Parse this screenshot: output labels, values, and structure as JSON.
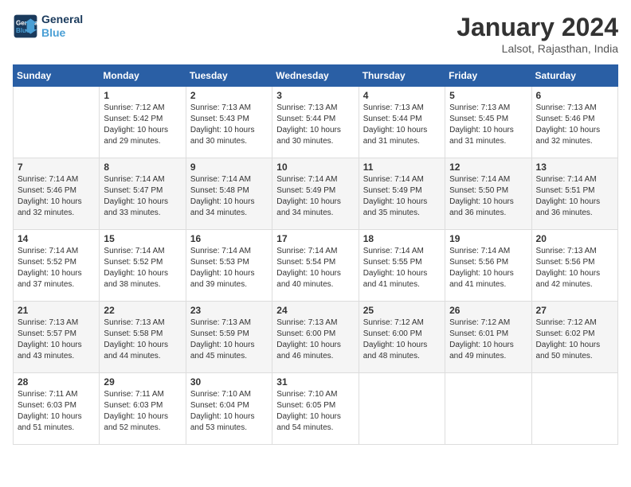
{
  "header": {
    "logo_line1": "General",
    "logo_line2": "Blue",
    "month": "January 2024",
    "location": "Lalsot, Rajasthan, India"
  },
  "days_of_week": [
    "Sunday",
    "Monday",
    "Tuesday",
    "Wednesday",
    "Thursday",
    "Friday",
    "Saturday"
  ],
  "weeks": [
    [
      {
        "day": "",
        "sunrise": "",
        "sunset": "",
        "daylight": ""
      },
      {
        "day": "1",
        "sunrise": "Sunrise: 7:12 AM",
        "sunset": "Sunset: 5:42 PM",
        "daylight": "Daylight: 10 hours and 29 minutes."
      },
      {
        "day": "2",
        "sunrise": "Sunrise: 7:13 AM",
        "sunset": "Sunset: 5:43 PM",
        "daylight": "Daylight: 10 hours and 30 minutes."
      },
      {
        "day": "3",
        "sunrise": "Sunrise: 7:13 AM",
        "sunset": "Sunset: 5:44 PM",
        "daylight": "Daylight: 10 hours and 30 minutes."
      },
      {
        "day": "4",
        "sunrise": "Sunrise: 7:13 AM",
        "sunset": "Sunset: 5:44 PM",
        "daylight": "Daylight: 10 hours and 31 minutes."
      },
      {
        "day": "5",
        "sunrise": "Sunrise: 7:13 AM",
        "sunset": "Sunset: 5:45 PM",
        "daylight": "Daylight: 10 hours and 31 minutes."
      },
      {
        "day": "6",
        "sunrise": "Sunrise: 7:13 AM",
        "sunset": "Sunset: 5:46 PM",
        "daylight": "Daylight: 10 hours and 32 minutes."
      }
    ],
    [
      {
        "day": "7",
        "sunrise": "Sunrise: 7:14 AM",
        "sunset": "Sunset: 5:46 PM",
        "daylight": "Daylight: 10 hours and 32 minutes."
      },
      {
        "day": "8",
        "sunrise": "Sunrise: 7:14 AM",
        "sunset": "Sunset: 5:47 PM",
        "daylight": "Daylight: 10 hours and 33 minutes."
      },
      {
        "day": "9",
        "sunrise": "Sunrise: 7:14 AM",
        "sunset": "Sunset: 5:48 PM",
        "daylight": "Daylight: 10 hours and 34 minutes."
      },
      {
        "day": "10",
        "sunrise": "Sunrise: 7:14 AM",
        "sunset": "Sunset: 5:49 PM",
        "daylight": "Daylight: 10 hours and 34 minutes."
      },
      {
        "day": "11",
        "sunrise": "Sunrise: 7:14 AM",
        "sunset": "Sunset: 5:49 PM",
        "daylight": "Daylight: 10 hours and 35 minutes."
      },
      {
        "day": "12",
        "sunrise": "Sunrise: 7:14 AM",
        "sunset": "Sunset: 5:50 PM",
        "daylight": "Daylight: 10 hours and 36 minutes."
      },
      {
        "day": "13",
        "sunrise": "Sunrise: 7:14 AM",
        "sunset": "Sunset: 5:51 PM",
        "daylight": "Daylight: 10 hours and 36 minutes."
      }
    ],
    [
      {
        "day": "14",
        "sunrise": "Sunrise: 7:14 AM",
        "sunset": "Sunset: 5:52 PM",
        "daylight": "Daylight: 10 hours and 37 minutes."
      },
      {
        "day": "15",
        "sunrise": "Sunrise: 7:14 AM",
        "sunset": "Sunset: 5:52 PM",
        "daylight": "Daylight: 10 hours and 38 minutes."
      },
      {
        "day": "16",
        "sunrise": "Sunrise: 7:14 AM",
        "sunset": "Sunset: 5:53 PM",
        "daylight": "Daylight: 10 hours and 39 minutes."
      },
      {
        "day": "17",
        "sunrise": "Sunrise: 7:14 AM",
        "sunset": "Sunset: 5:54 PM",
        "daylight": "Daylight: 10 hours and 40 minutes."
      },
      {
        "day": "18",
        "sunrise": "Sunrise: 7:14 AM",
        "sunset": "Sunset: 5:55 PM",
        "daylight": "Daylight: 10 hours and 41 minutes."
      },
      {
        "day": "19",
        "sunrise": "Sunrise: 7:14 AM",
        "sunset": "Sunset: 5:56 PM",
        "daylight": "Daylight: 10 hours and 41 minutes."
      },
      {
        "day": "20",
        "sunrise": "Sunrise: 7:13 AM",
        "sunset": "Sunset: 5:56 PM",
        "daylight": "Daylight: 10 hours and 42 minutes."
      }
    ],
    [
      {
        "day": "21",
        "sunrise": "Sunrise: 7:13 AM",
        "sunset": "Sunset: 5:57 PM",
        "daylight": "Daylight: 10 hours and 43 minutes."
      },
      {
        "day": "22",
        "sunrise": "Sunrise: 7:13 AM",
        "sunset": "Sunset: 5:58 PM",
        "daylight": "Daylight: 10 hours and 44 minutes."
      },
      {
        "day": "23",
        "sunrise": "Sunrise: 7:13 AM",
        "sunset": "Sunset: 5:59 PM",
        "daylight": "Daylight: 10 hours and 45 minutes."
      },
      {
        "day": "24",
        "sunrise": "Sunrise: 7:13 AM",
        "sunset": "Sunset: 6:00 PM",
        "daylight": "Daylight: 10 hours and 46 minutes."
      },
      {
        "day": "25",
        "sunrise": "Sunrise: 7:12 AM",
        "sunset": "Sunset: 6:00 PM",
        "daylight": "Daylight: 10 hours and 48 minutes."
      },
      {
        "day": "26",
        "sunrise": "Sunrise: 7:12 AM",
        "sunset": "Sunset: 6:01 PM",
        "daylight": "Daylight: 10 hours and 49 minutes."
      },
      {
        "day": "27",
        "sunrise": "Sunrise: 7:12 AM",
        "sunset": "Sunset: 6:02 PM",
        "daylight": "Daylight: 10 hours and 50 minutes."
      }
    ],
    [
      {
        "day": "28",
        "sunrise": "Sunrise: 7:11 AM",
        "sunset": "Sunset: 6:03 PM",
        "daylight": "Daylight: 10 hours and 51 minutes."
      },
      {
        "day": "29",
        "sunrise": "Sunrise: 7:11 AM",
        "sunset": "Sunset: 6:03 PM",
        "daylight": "Daylight: 10 hours and 52 minutes."
      },
      {
        "day": "30",
        "sunrise": "Sunrise: 7:10 AM",
        "sunset": "Sunset: 6:04 PM",
        "daylight": "Daylight: 10 hours and 53 minutes."
      },
      {
        "day": "31",
        "sunrise": "Sunrise: 7:10 AM",
        "sunset": "Sunset: 6:05 PM",
        "daylight": "Daylight: 10 hours and 54 minutes."
      },
      {
        "day": "",
        "sunrise": "",
        "sunset": "",
        "daylight": ""
      },
      {
        "day": "",
        "sunrise": "",
        "sunset": "",
        "daylight": ""
      },
      {
        "day": "",
        "sunrise": "",
        "sunset": "",
        "daylight": ""
      }
    ]
  ]
}
